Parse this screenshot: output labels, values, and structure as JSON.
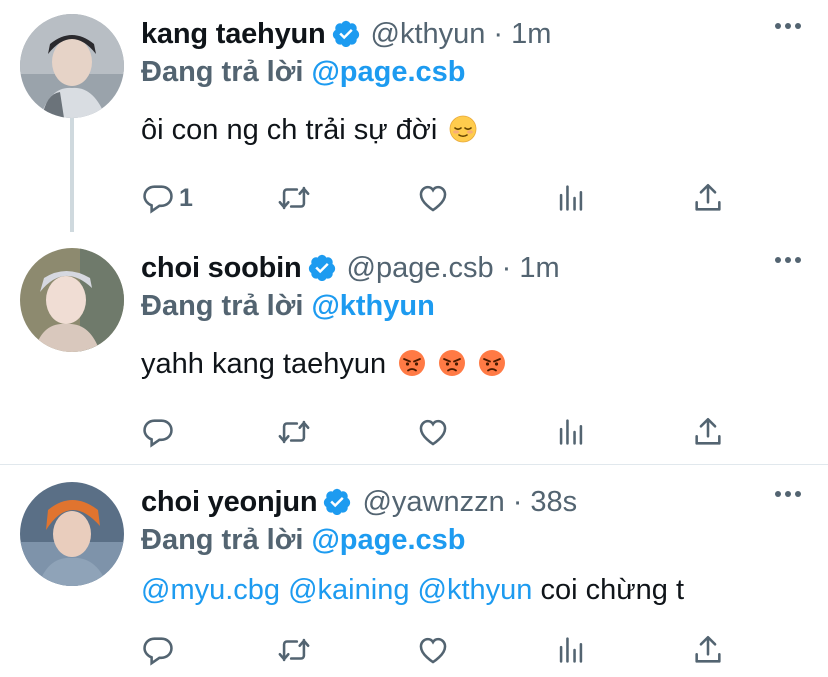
{
  "tweets": [
    {
      "name": "kang taehyun",
      "handle": "@kthyun",
      "time": "1m",
      "reply_label": "Đang trả lời",
      "reply_to": "@page.csb",
      "text": "ôi con ng ch trải sự đời",
      "emojis": [
        "relieved-face"
      ],
      "reply_count": "1"
    },
    {
      "name": "choi soobin",
      "handle": "@page.csb",
      "time": "1m",
      "reply_label": "Đang trả lời",
      "reply_to": "@kthyun",
      "text": "yahh kang taehyun",
      "emojis": [
        "angry-face",
        "angry-face",
        "angry-face"
      ],
      "reply_count": ""
    },
    {
      "name": "choi yeonjun",
      "handle": "@yawnzzn",
      "time": "38s",
      "reply_label": "Đang trả lời",
      "reply_to": "@page.csb",
      "mentions": [
        "@myu.cbg",
        "@kaining",
        "@kthyun"
      ],
      "text": "coi chừng t",
      "reply_count": ""
    }
  ],
  "separator": "·",
  "colors": {
    "accent": "#1d9bf0",
    "secondary_text": "#536471",
    "primary_text": "#0f1419",
    "divider": "#e1e8ed"
  }
}
